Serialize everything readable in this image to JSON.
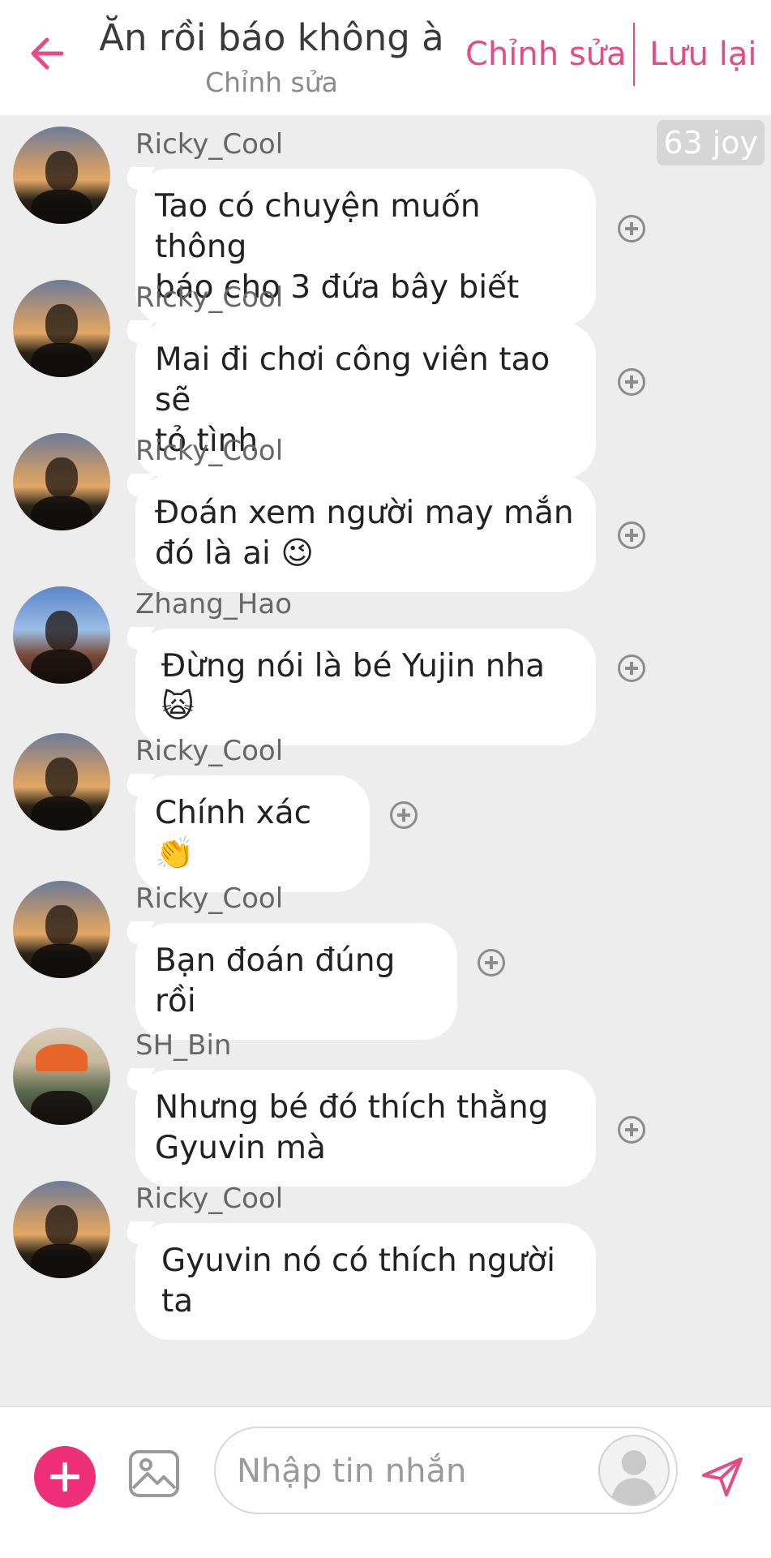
{
  "header": {
    "title": "Ăn rồi báo không à",
    "subtitle": "Chỉnh sửa",
    "edit_label": "Chỉnh sửa",
    "save_label": "Lưu lại",
    "accent_color": "#e64b85"
  },
  "chat": {
    "joy_badge": "63 joy",
    "messages": [
      {
        "sender": "Ricky_Cool",
        "text_line1": "Tao có chuyện muốn thông",
        "text_line2": "báo cho 3 đứa bây biết"
      },
      {
        "sender": "Ricky_Cool",
        "text_line1": "Mai đi chơi công viên tao sẽ",
        "text_line2": "tỏ tình"
      },
      {
        "sender": "Ricky_Cool",
        "text_line1": "Đoán xem người may mắn",
        "text_line2": "đó là ai 😉"
      },
      {
        "sender": "Zhang_Hao",
        "text_line1": "Đừng nói là bé Yujin nha 🙀"
      },
      {
        "sender": "Ricky_Cool",
        "text_line1": "Chính xác 👏"
      },
      {
        "sender": "Ricky_Cool",
        "text_line1": "Bạn đoán đúng rồi"
      },
      {
        "sender": "SH_Bin",
        "text_line1": "Nhưng bé đó thích thằng",
        "text_line2": "Gyuvin mà"
      },
      {
        "sender": "Ricky_Cool",
        "text_line1": "Gyuvin nó có thích người ta"
      }
    ]
  },
  "composer": {
    "placeholder": "Nhập tin nhắn",
    "icons": [
      "plus-icon",
      "image-icon",
      "user-placeholder-icon",
      "send-icon"
    ]
  }
}
